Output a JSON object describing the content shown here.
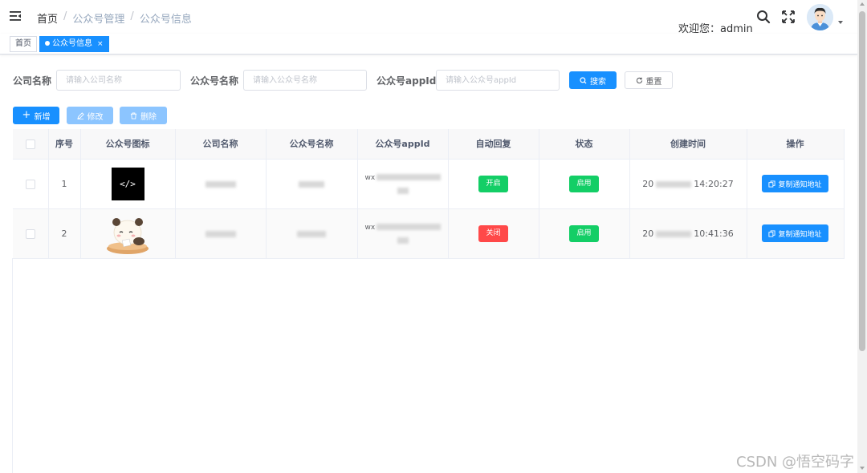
{
  "breadcrumb": [
    "首页",
    "公众号管理",
    "公众号信息"
  ],
  "header": {
    "welcome": "欢迎您：admin"
  },
  "tags": [
    {
      "label": "首页",
      "active": false
    },
    {
      "label": "公众号信息",
      "active": true,
      "close": "×"
    }
  ],
  "search": {
    "company_label": "公司名称",
    "company_placeholder": "请输入公司名称",
    "name_label": "公众号名称",
    "name_placeholder": "请输入公众号名称",
    "appid_label": "公众号appId",
    "appid_placeholder": "请输入公众号appId",
    "search_btn": "搜索",
    "reset_btn": "重置"
  },
  "toolbar": {
    "add": "新增",
    "edit": "修改",
    "delete": "删除"
  },
  "table": {
    "headers": [
      "序号",
      "公众号图标",
      "公司名称",
      "公众号名称",
      "公众号appId",
      "自动回复",
      "状态",
      "创建时间",
      "操作"
    ],
    "rows": [
      {
        "index": "1",
        "icon": "code-logo-icon",
        "logo_text": "</>",
        "appid_prefix": "wx",
        "auto_reply": "开启",
        "auto_reply_color": "#13ce66",
        "status": "启用",
        "time_prefix": "20",
        "time_suffix": "14:20:27",
        "action": "复制通知地址"
      },
      {
        "index": "2",
        "icon": "panda-avatar-icon",
        "appid_prefix": "wx",
        "auto_reply": "关闭",
        "auto_reply_color": "#ff4949",
        "status": "启用",
        "time_prefix": "20",
        "time_suffix": "10:41:36",
        "action": "复制通知地址"
      }
    ]
  },
  "watermark": "CSDN @悟空码字"
}
